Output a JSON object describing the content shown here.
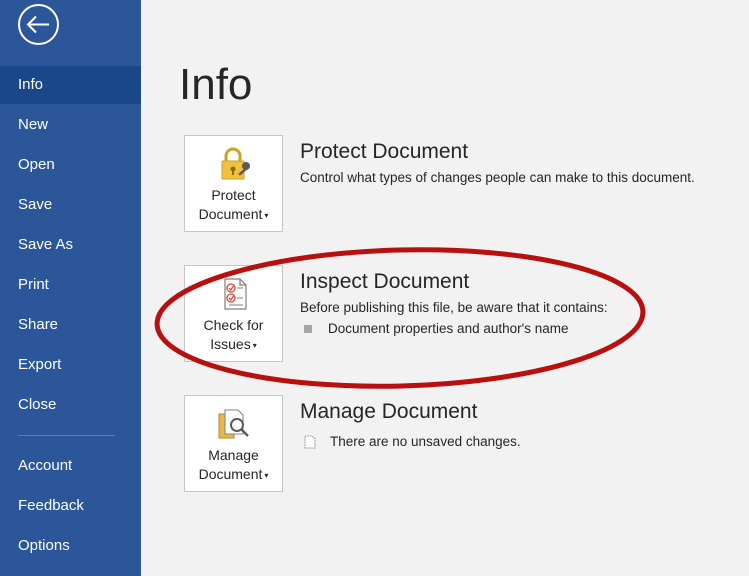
{
  "sidebar": {
    "items": [
      {
        "label": "Info",
        "selected": true
      },
      {
        "label": "New"
      },
      {
        "label": "Open"
      },
      {
        "label": "Save"
      },
      {
        "label": "Save As"
      },
      {
        "label": "Print"
      },
      {
        "label": "Share"
      },
      {
        "label": "Export"
      },
      {
        "label": "Close"
      }
    ],
    "bottom_items": [
      {
        "label": "Account"
      },
      {
        "label": "Feedback"
      },
      {
        "label": "Options"
      }
    ],
    "back_icon": "back-arrow-icon",
    "color": "#2b579a",
    "selected_color": "#19478a"
  },
  "main": {
    "title": "Info",
    "sections": {
      "protect": {
        "tile_line1": "Protect",
        "tile_line2": "Document",
        "icon": "padlock-key-icon",
        "title": "Protect Document",
        "description": "Control what types of changes people can make to this document."
      },
      "inspect": {
        "tile_line1": "Check for",
        "tile_line2": "Issues",
        "icon": "checklist-icon",
        "title": "Inspect Document",
        "description": "Before publishing this file, be aware that it contains:",
        "bullets": [
          "Document properties and author's name"
        ]
      },
      "manage": {
        "tile_line1": "Manage",
        "tile_line2": "Document",
        "icon": "document-search-icon",
        "title": "Manage Document",
        "status": "There are no unsaved changes."
      }
    }
  },
  "annotation": {
    "shape": "ellipse",
    "color": "#b80f0f",
    "target": "inspect"
  }
}
